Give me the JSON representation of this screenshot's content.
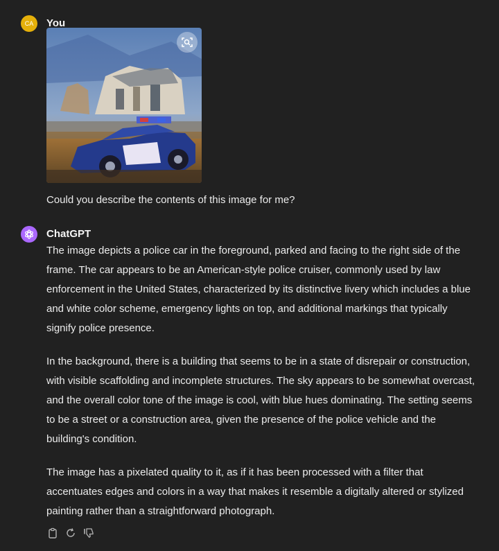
{
  "user": {
    "initials": "CA",
    "name": "You",
    "prompt": "Could you describe the contents of this image for me?"
  },
  "assistant": {
    "name": "ChatGPT",
    "paragraphs": [
      "The image depicts a police car in the foreground, parked and facing to the right side of the frame. The car appears to be an American-style police cruiser, commonly used by law enforcement in the United States, characterized by its distinctive livery which includes a blue and white color scheme, emergency lights on top, and additional markings that typically signify police presence.",
      "In the background, there is a building that seems to be in a state of disrepair or construction, with visible scaffolding and incomplete structures. The sky appears to be somewhat overcast, and the overall color tone of the image is cool, with blue hues dominating. The setting seems to be a street or a construction area, given the presence of the police vehicle and the building's condition.",
      "The image has a pixelated quality to it, as if it has been processed with a filter that accentuates edges and colors in a way that makes it resemble a digitally altered or stylized painting rather than a straightforward photograph."
    ]
  },
  "icons": {
    "image_search": "image-search-icon",
    "copy": "copy-icon",
    "regenerate": "regenerate-icon",
    "thumbs_down": "thumbs-down-icon"
  }
}
